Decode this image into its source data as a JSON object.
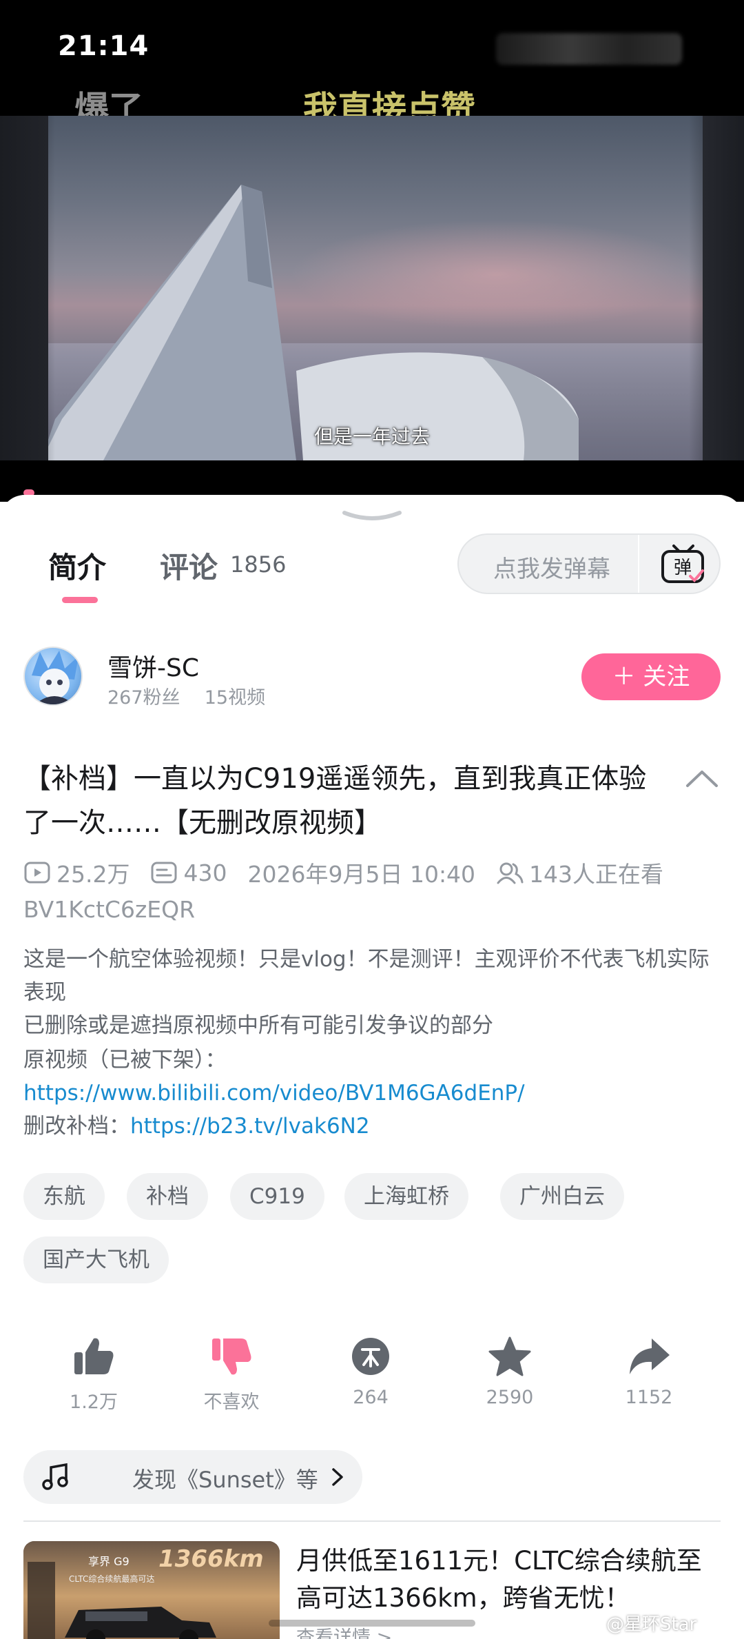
{
  "status_bar": {
    "time": "21:14"
  },
  "video": {
    "overlay_left": "爆了",
    "overlay_center": "我直接点赞",
    "subtitle": "但是一年过去"
  },
  "tabs": {
    "intro_label": "简介",
    "comments_label": "评论",
    "comments_count": "1856"
  },
  "danmaku": {
    "placeholder": "点我发弹幕",
    "button_label": "弹"
  },
  "author": {
    "name": "雪饼-SC",
    "fans": "267粉丝",
    "videos": "15视频",
    "follow_label": "＋ 关注"
  },
  "video_info": {
    "title": "【补档】一直以为C919遥遥领先，直到我真正体验了一次……【无删改原视频】",
    "views": "25.2万",
    "danmaku_count": "430",
    "publish_time": "2026年9月5日 10:40",
    "watching": "143人正在看",
    "bvid": "BV1KctC6zEQR"
  },
  "description": {
    "line1": "这是一个航空体验视频！只是vlog！不是测评！主观评价不代表飞机实际表现",
    "line2": "已删除或是遮挡原视频中所有可能引发争议的部分",
    "line3_prefix": "原视频（已被下架）：",
    "line3_link": "https://www.bilibili.com/video/BV1M6GA6dEnP/",
    "line4_prefix": "删改补档：",
    "line4_link": "https://b23.tv/lvak6N2"
  },
  "tags": [
    "东航",
    "补档",
    "C919",
    "上海虹桥",
    "广州白云",
    "国产大飞机"
  ],
  "actions": {
    "like": "1.2万",
    "dislike": "不喜欢",
    "coin": "264",
    "favorite": "2590",
    "share": "1152"
  },
  "music": {
    "text": "发现《Sunset》等"
  },
  "ad": {
    "brand_text": "享界 G9",
    "km_text": "1366km",
    "sub_text": "CLTC综合续航最高可达",
    "title": "月供低至1611元！CLTC综合续航至高可达1366km，跨省无忧！",
    "more": "查看详情 >"
  },
  "watermark": "@星环Star",
  "colors": {
    "accent_pink": "#fb7299",
    "follow_pink": "#ff6699",
    "link_blue": "#178bcf"
  }
}
